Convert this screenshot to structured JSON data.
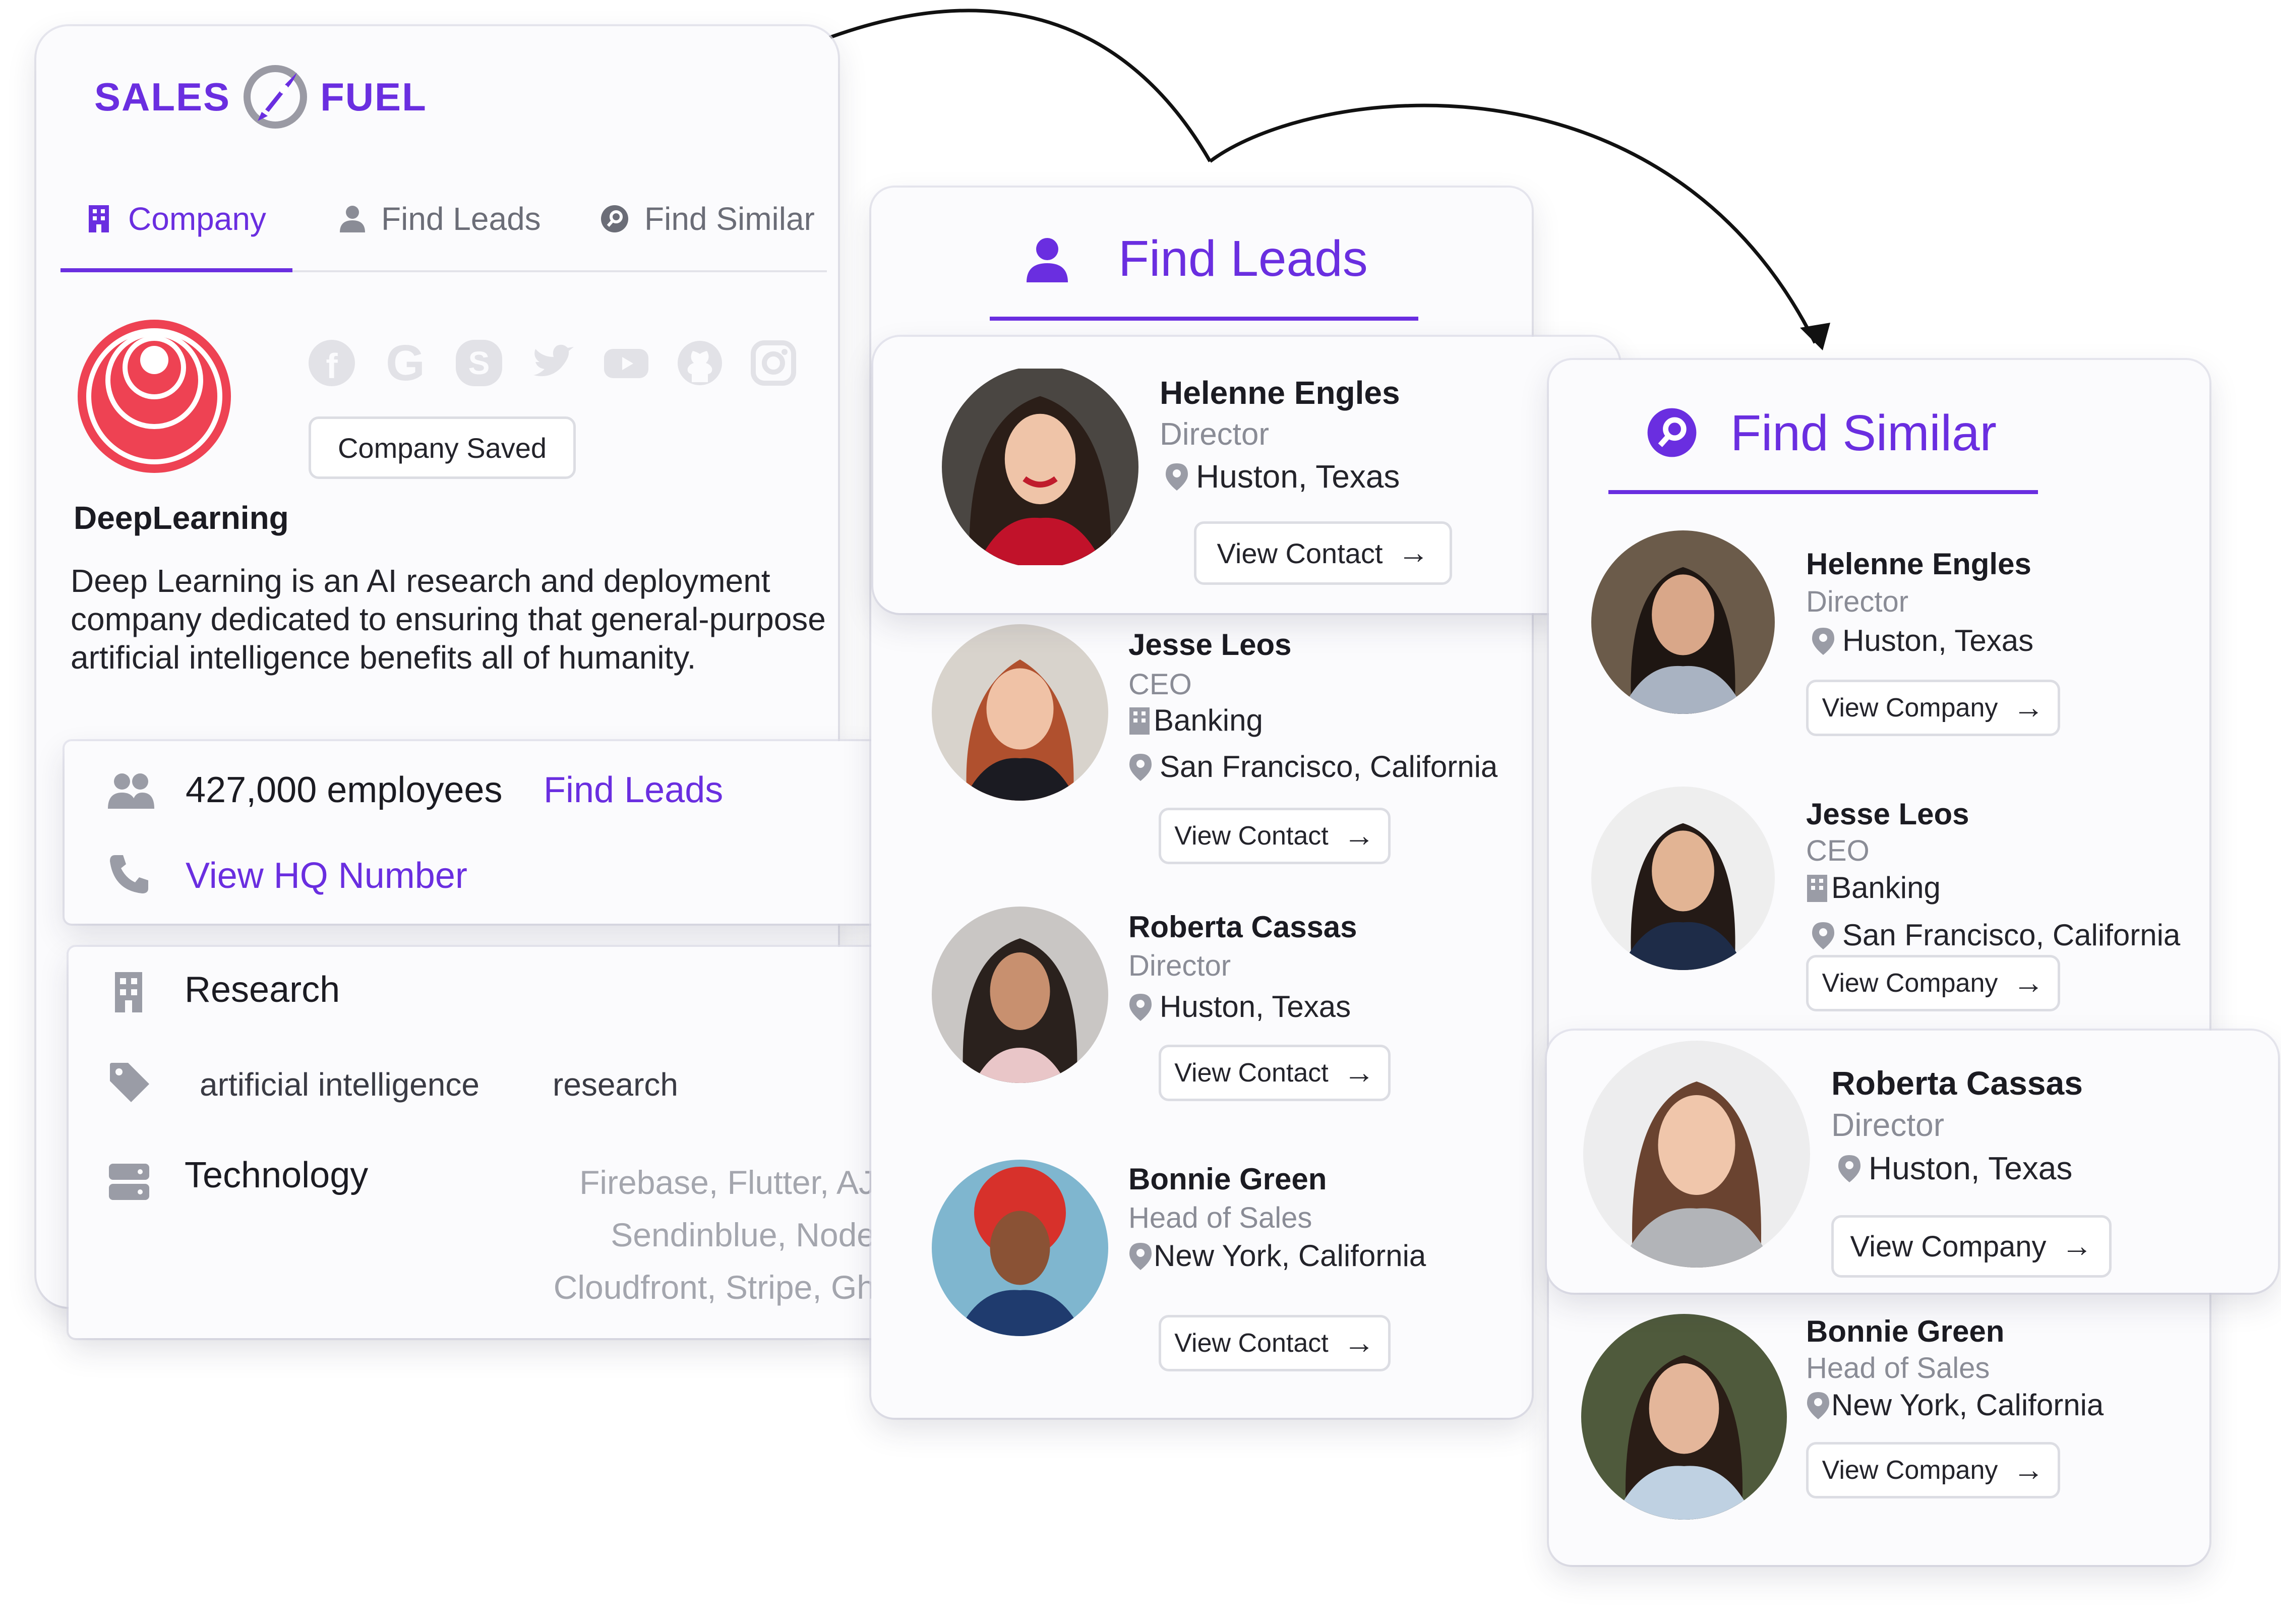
{
  "brand": {
    "part1": "SALES",
    "part2": "FUEL",
    "accent": "#6a2ee0",
    "icon": "rocket-icon"
  },
  "company_panel": {
    "tabs": [
      {
        "label": "Company",
        "icon": "building-icon",
        "active": true
      },
      {
        "label": "Find Leads",
        "icon": "person-icon",
        "active": false
      },
      {
        "label": "Find Similar",
        "icon": "search-circle-icon",
        "active": false
      }
    ],
    "social_icons": [
      "facebook-icon",
      "google-icon",
      "skype-icon",
      "twitter-icon",
      "youtube-icon",
      "github-icon",
      "instagram-icon"
    ],
    "saved_button": "Company Saved",
    "company_name": "DeepLearning",
    "description": "Deep Learning is an AI research and deployment company dedicated to ensuring that general-purpose artificial intelligence benefits all of humanity.",
    "employees": "427,000 employees",
    "find_leads_link": "Find Leads",
    "hq_link": "View HQ Number",
    "industry": "Research",
    "tags": [
      "artificial intelligence",
      "research"
    ],
    "tech_label": "Technology",
    "tech_lines": [
      "Firebase, Flutter, AJ",
      "Sendinblue, Node",
      "Cloudfront, Stripe, Gh"
    ]
  },
  "find_leads": {
    "title": "Find Leads",
    "button_label": "View Contact",
    "leads": [
      {
        "name": "Helenne Engles",
        "title": "Director",
        "location": "Huston, Texas"
      },
      {
        "name": "Jesse Leos",
        "title": "CEO",
        "industry": "Banking",
        "location": "San Francisco, California"
      },
      {
        "name": "Roberta Cassas",
        "title": "Director",
        "location": "Huston, Texas"
      },
      {
        "name": "Bonnie Green",
        "title": "Head of Sales",
        "location": "New York, California"
      }
    ]
  },
  "find_similar": {
    "title": "Find Similar",
    "button_label": "View Company",
    "items": [
      {
        "name": "Helenne Engles",
        "title": "Director",
        "location": "Huston, Texas"
      },
      {
        "name": "Jesse Leos",
        "title": "CEO",
        "industry": "Banking",
        "location": "San Francisco, California"
      },
      {
        "name": "Roberta Cassas",
        "title": "Director",
        "location": "Huston, Texas"
      },
      {
        "name": "Bonnie Green",
        "title": "Head of Sales",
        "location": "New York, California"
      }
    ]
  }
}
